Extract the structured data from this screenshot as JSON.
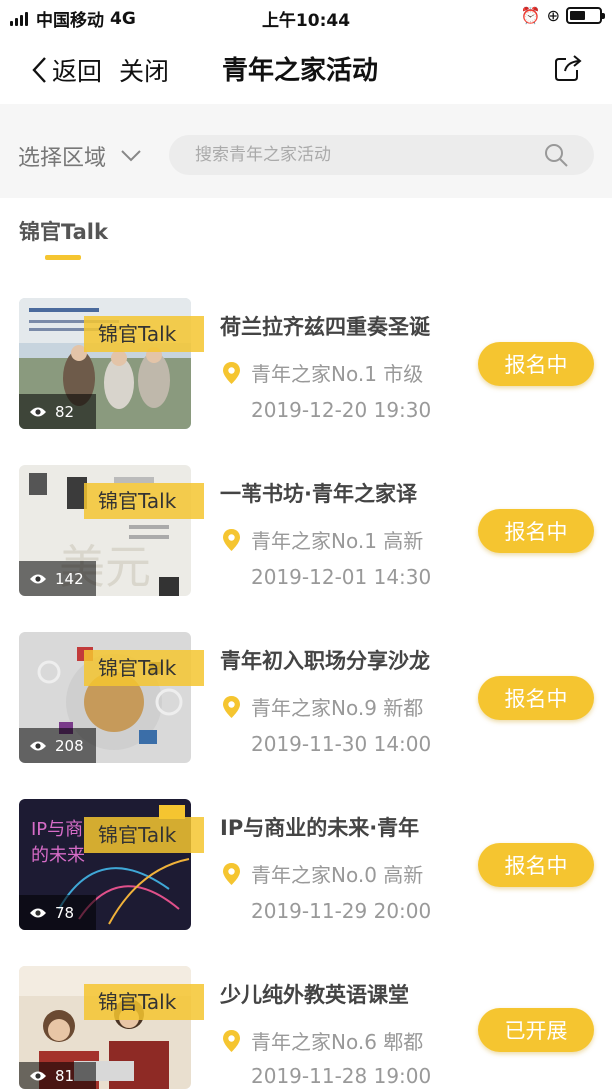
{
  "status_bar": {
    "carrier": "中国移动",
    "network": "4G",
    "time": "上午10:44"
  },
  "nav": {
    "back_label": "返回",
    "close_label": "关闭",
    "title": "青年之家活动"
  },
  "filter": {
    "region_label": "选择区域",
    "search_placeholder": "搜索青年之家活动"
  },
  "section": {
    "tab_label": "锦官Talk"
  },
  "colors": {
    "accent": "#f5c530",
    "text_gray": "#999999"
  },
  "activities": [
    {
      "tag": "锦官Talk",
      "views": "82",
      "title": "荷兰拉齐兹四重奏圣诞",
      "place": "青年之家No.1 市级",
      "date": "2019-12-20 19:30",
      "status": "报名中"
    },
    {
      "tag": "锦官Talk",
      "views": "142",
      "title": "一苇书坊·青年之家译",
      "place": "青年之家No.1 高新",
      "date": "2019-12-01 14:30",
      "status": "报名中"
    },
    {
      "tag": "锦官Talk",
      "views": "208",
      "title": "青年初入职场分享沙龙",
      "place": "青年之家No.9 新都",
      "date": "2019-11-30 14:00",
      "status": "报名中"
    },
    {
      "tag": "锦官Talk",
      "views": "78",
      "title": "IP与商业的未来·青年",
      "place": "青年之家No.0 高新",
      "date": "2019-11-29 20:00",
      "status": "报名中"
    },
    {
      "tag": "锦官Talk",
      "views": "81",
      "title": "少儿纯外教英语课堂",
      "place": "青年之家No.6 郫都",
      "date": "2019-11-28 19:00",
      "status": "已开展"
    }
  ]
}
